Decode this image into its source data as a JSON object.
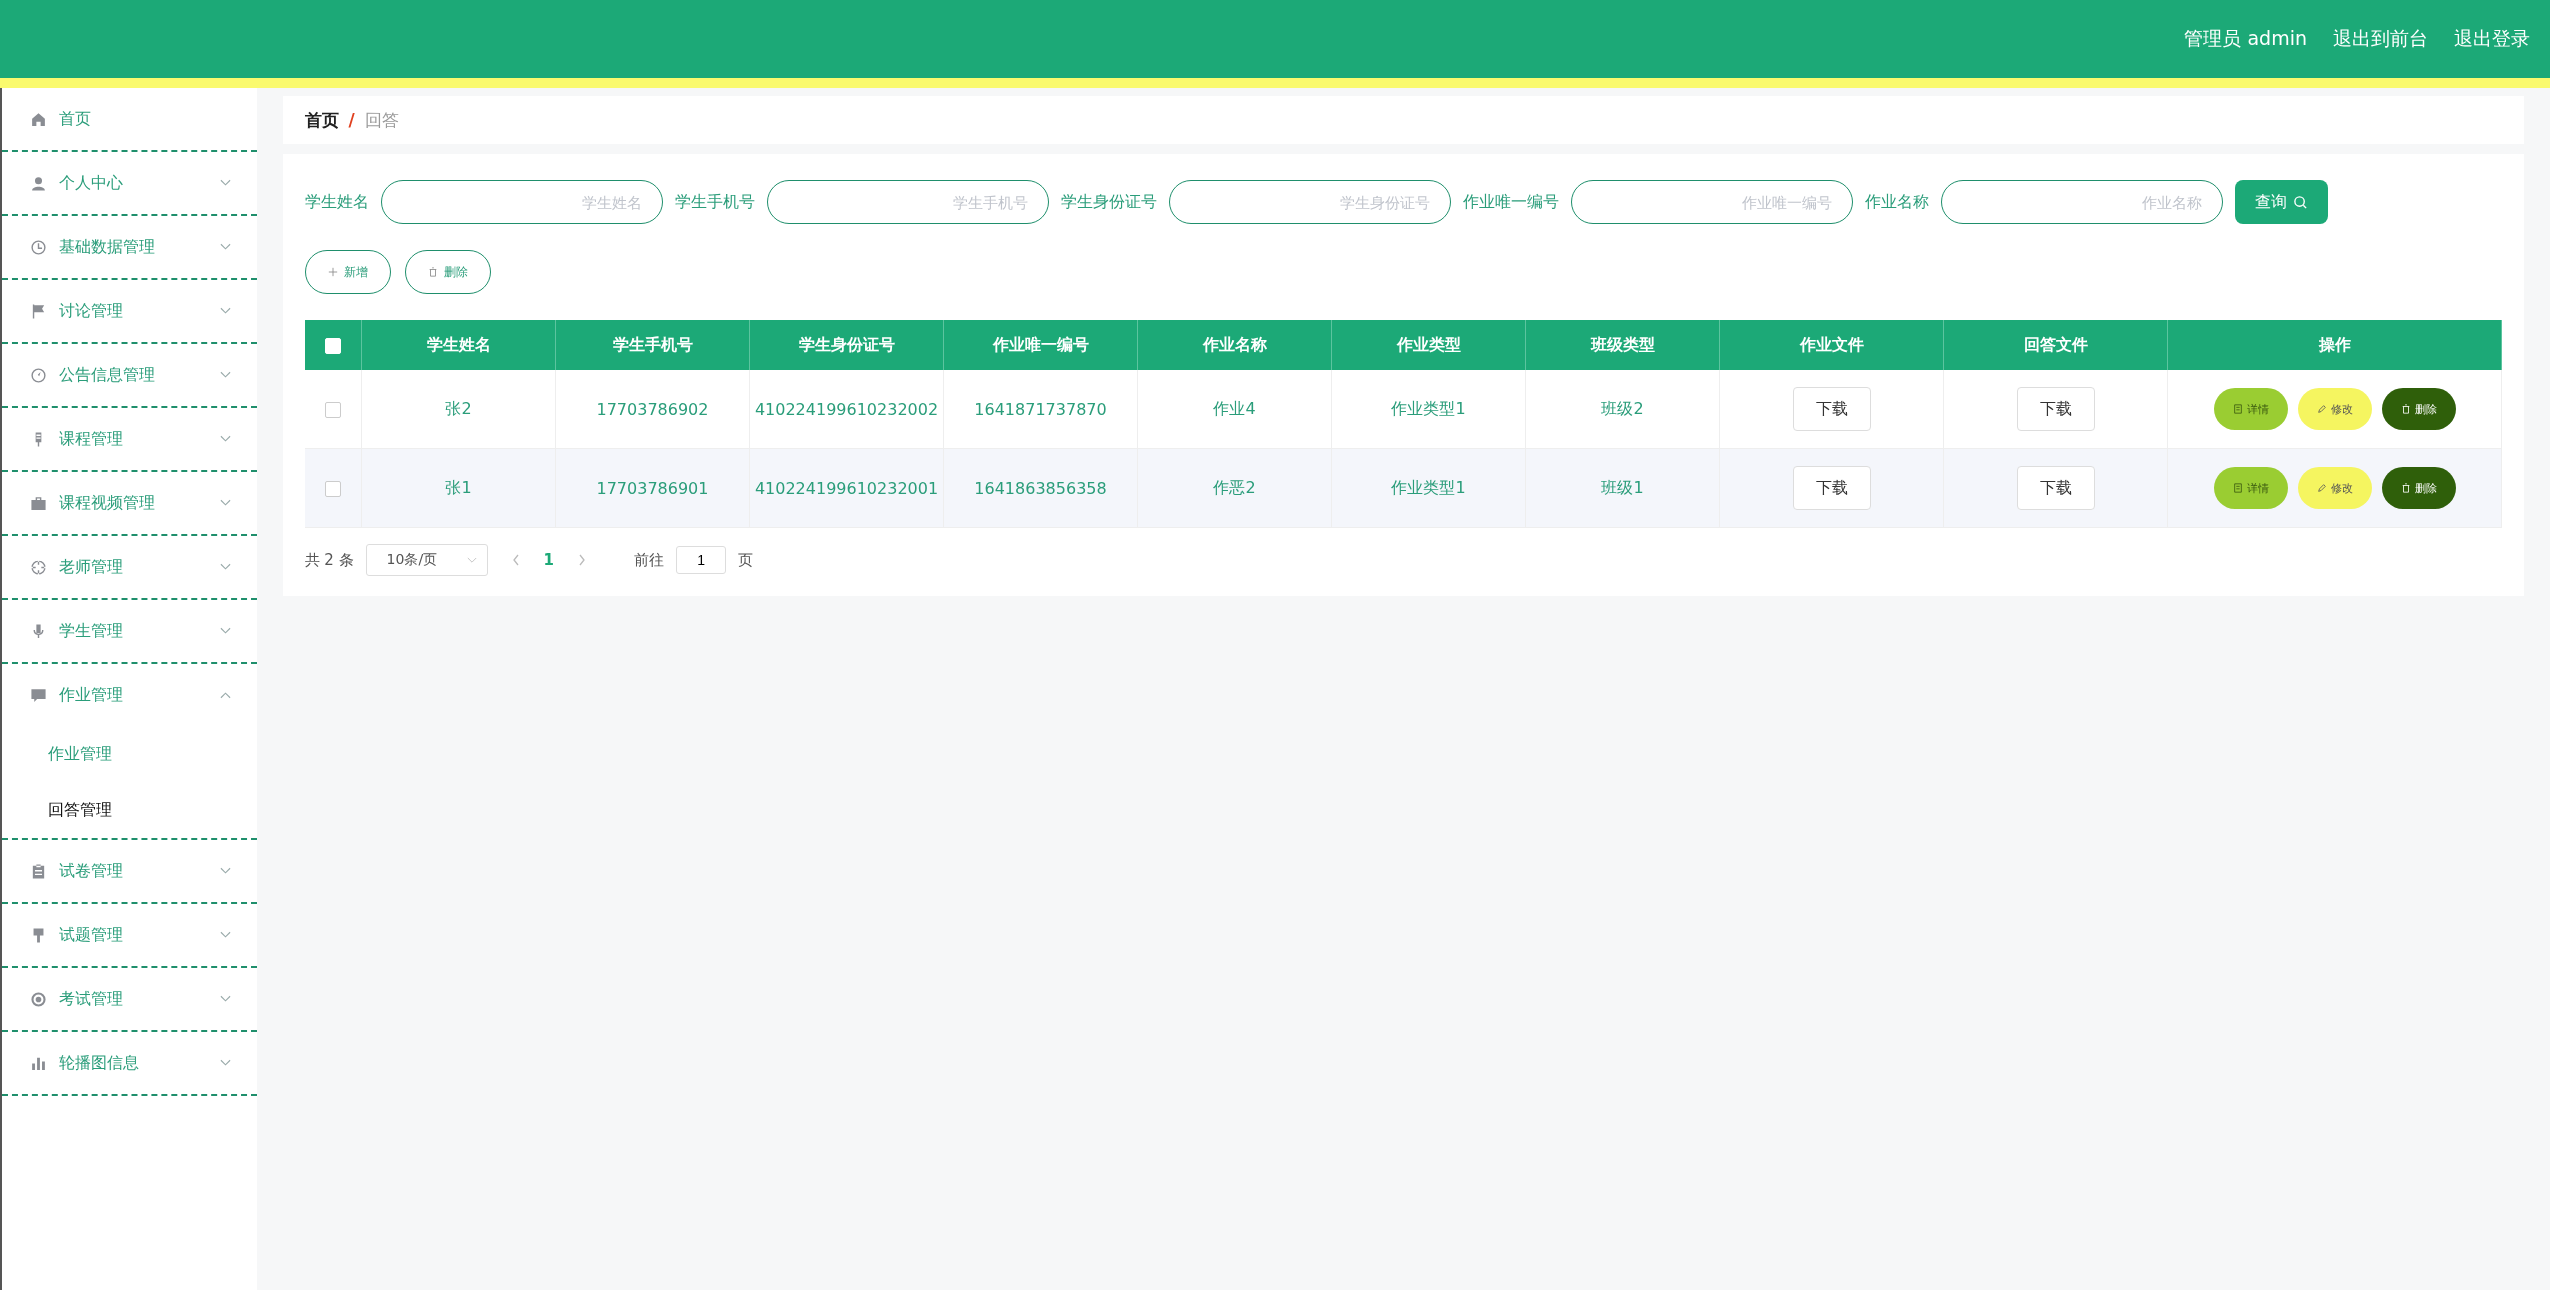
{
  "header": {
    "links": [
      "管理员 admin",
      "退出到前台",
      "退出登录"
    ]
  },
  "sidebar": {
    "items": [
      {
        "label": "首页",
        "has_arrow": false
      },
      {
        "label": "个人中心",
        "expanded": false,
        "has_arrow": true
      },
      {
        "label": "基础数据管理",
        "expanded": false,
        "has_arrow": true
      },
      {
        "label": "讨论管理",
        "expanded": false,
        "has_arrow": true
      },
      {
        "label": "公告信息管理",
        "expanded": false,
        "has_arrow": true
      },
      {
        "label": "课程管理",
        "expanded": false,
        "has_arrow": true
      },
      {
        "label": "课程视频管理",
        "expanded": false,
        "has_arrow": true
      },
      {
        "label": "老师管理",
        "expanded": false,
        "has_arrow": true
      },
      {
        "label": "学生管理",
        "expanded": false,
        "has_arrow": true
      },
      {
        "label": "作业管理",
        "expanded": true,
        "has_arrow": true,
        "children": [
          {
            "label": "作业管理",
            "selected": false
          },
          {
            "label": "回答管理",
            "selected": true
          }
        ]
      },
      {
        "label": "试卷管理",
        "expanded": false,
        "has_arrow": true
      },
      {
        "label": "试题管理",
        "expanded": false,
        "has_arrow": true
      },
      {
        "label": "考试管理",
        "expanded": false,
        "has_arrow": true
      },
      {
        "label": "轮播图信息",
        "expanded": false,
        "has_arrow": true
      }
    ]
  },
  "breadcrumb": {
    "home": "首页",
    "separator": "/",
    "current": "回答"
  },
  "search": {
    "fields": [
      {
        "label": "学生姓名",
        "placeholder": "学生姓名"
      },
      {
        "label": "学生手机号",
        "placeholder": "学生手机号"
      },
      {
        "label": "学生身份证号",
        "placeholder": "学生身份证号"
      },
      {
        "label": "作业唯一编号",
        "placeholder": "作业唯一编号"
      },
      {
        "label": "作业名称",
        "placeholder": "作业名称"
      }
    ],
    "button": "查询"
  },
  "actions": [
    {
      "kind": "add",
      "label": "新增"
    },
    {
      "kind": "delete",
      "label": "删除"
    }
  ],
  "table": {
    "header_checked": false,
    "columns": [
      "学生姓名",
      "学生手机号",
      "学生身份证号",
      "作业唯一编号",
      "作业名称",
      "作业类型",
      "班级类型",
      "作业文件",
      "回答文件",
      "操作"
    ],
    "rows": [
      {
        "checked": false,
        "cells": [
          "张2",
          "17703786902",
          "410224199610232002",
          "1641871737870",
          "作业4",
          "作业类型1",
          "班级2"
        ],
        "files": [
          "下载",
          "下载"
        ],
        "ops": [
          {
            "kind": "detail",
            "label": "详情"
          },
          {
            "kind": "edit",
            "label": "修改"
          },
          {
            "kind": "delete",
            "label": "删除"
          }
        ]
      },
      {
        "checked": false,
        "cells": [
          "张1",
          "17703786901",
          "410224199610232001",
          "1641863856358",
          "作恶2",
          "作业类型1",
          "班级1"
        ],
        "files": [
          "下载",
          "下载"
        ],
        "ops": [
          {
            "kind": "detail",
            "label": "详情"
          },
          {
            "kind": "edit",
            "label": "修改"
          },
          {
            "kind": "delete",
            "label": "删除"
          }
        ]
      }
    ]
  },
  "pagination": {
    "total": "共 2 条",
    "page_size": "10条/页",
    "pages": [
      {
        "label": "1",
        "selected": true
      }
    ],
    "goto_label": "前往",
    "goto_value": "1",
    "goto_suffix": "页"
  }
}
